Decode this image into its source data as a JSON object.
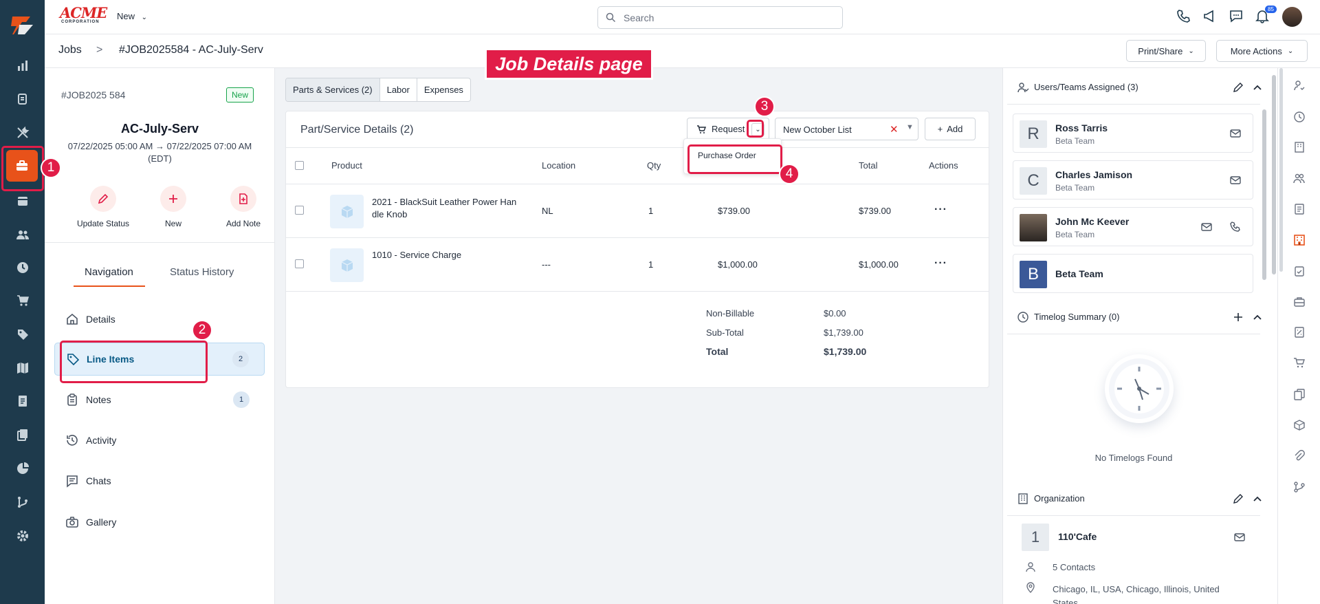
{
  "app": {
    "brand": "ACME",
    "brand_sub": "CORPORATION",
    "new_menu": "New",
    "search_placeholder": "Search",
    "notification_count": "85"
  },
  "breadcrumb": {
    "root": "Jobs",
    "separator": ">",
    "current": "#JOB2025584 - AC-July-Serv"
  },
  "header_actions": {
    "print_share": "Print/Share",
    "more_actions": "More Actions"
  },
  "annotation": {
    "title": "Job Details page",
    "markers": [
      "1",
      "2",
      "3",
      "4"
    ]
  },
  "job": {
    "number": "#JOB2025 584",
    "status": "New",
    "title": "AC-July-Serv",
    "date_line1": "07/22/2025 05:00 AM → 07/22/2025 07:00 AM",
    "date_line2": "(EDT)"
  },
  "quick_actions": [
    {
      "label": "Update Status",
      "icon": "pencil-icon"
    },
    {
      "label": "New",
      "icon": "plus-icon"
    },
    {
      "label": "Add Note",
      "icon": "note-add-icon"
    }
  ],
  "left_tabs": {
    "navigation": "Navigation",
    "status_history": "Status History"
  },
  "nav": [
    {
      "label": "Details",
      "icon": "home-icon",
      "count": ""
    },
    {
      "label": "Line Items",
      "icon": "tag-icon",
      "count": "2"
    },
    {
      "label": "Notes",
      "icon": "clipboard-icon",
      "count": "1"
    },
    {
      "label": "Activity",
      "icon": "history-icon",
      "count": ""
    },
    {
      "label": "Chats",
      "icon": "chat-icon",
      "count": ""
    },
    {
      "label": "Gallery",
      "icon": "camera-icon",
      "count": ""
    }
  ],
  "main_tabs": [
    "Parts & Services (2)",
    "Labor",
    "Expenses"
  ],
  "parts": {
    "title": "Part/Service Details (2)",
    "request_label": "Request",
    "list_value": "New October List",
    "add_label": "Add",
    "dropdown_item": "Purchase Order",
    "columns": [
      "Product",
      "Location",
      "Qty",
      "Total",
      "Actions"
    ],
    "rows": [
      {
        "product_line1": "2021 - BlackSuit Leather Power Han",
        "product_line2": "dle Knob",
        "location": "NL",
        "qty": "1",
        "price": "$739.00",
        "total": "$739.00"
      },
      {
        "product_line1": "1010 - Service Charge",
        "product_line2": "",
        "location": "---",
        "qty": "1",
        "price": "$1,000.00",
        "total": "$1,000.00"
      }
    ],
    "summary": {
      "non_billable_label": "Non-Billable",
      "non_billable": "$0.00",
      "subtotal_label": "Sub-Total",
      "subtotal": "$1,739.00",
      "total_label": "Total",
      "total": "$1,739.00"
    }
  },
  "users_section": {
    "title": "Users/Teams Assigned (3)",
    "users": [
      {
        "initial": "R",
        "name": "Ross Tarris",
        "team": "Beta Team"
      },
      {
        "initial": "C",
        "name": "Charles Jamison",
        "team": "Beta Team"
      },
      {
        "initial": "",
        "name": "John Mc Keever",
        "team": "Beta Team"
      },
      {
        "initial": "B",
        "name": "Beta Team",
        "team": ""
      }
    ]
  },
  "timelog": {
    "title": "Timelog Summary (0)",
    "empty": "No Timelogs Found"
  },
  "organization": {
    "title": "Organization",
    "initial": "1",
    "name": "110'Cafe",
    "contacts": "5 Contacts",
    "address_line1": "Chicago, IL, USA, Chicago, Illinois, United",
    "address_line2": "States"
  },
  "colors": {
    "accent": "#e8521a",
    "annotation": "#e11d48",
    "rail": "#1e3a4c",
    "active_nav": "#e3f0fb"
  }
}
